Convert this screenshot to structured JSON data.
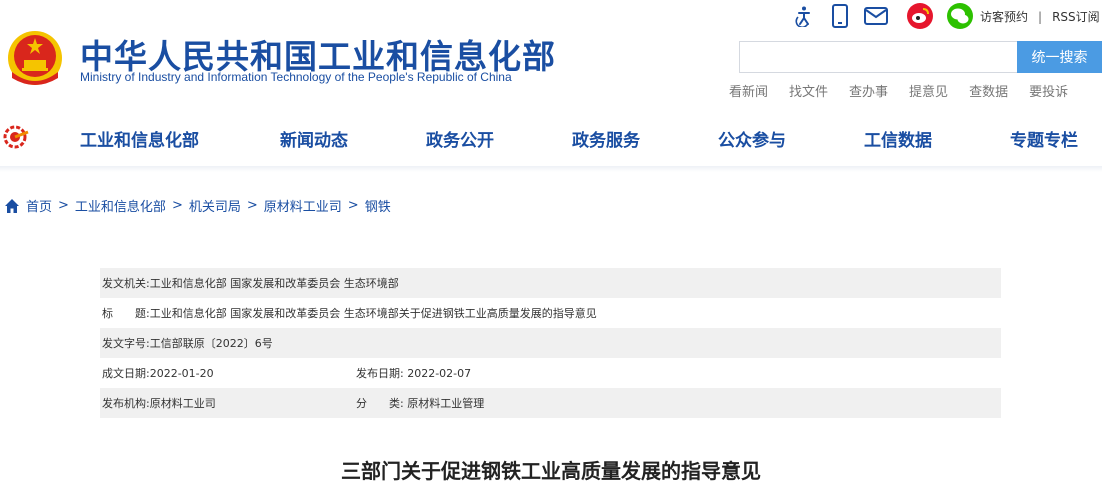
{
  "header": {
    "title_cn": "中华人民共和国工业和信息化部",
    "title_en": "Ministry of Industry and Information Technology of the People's Republic of China",
    "util_icons": [
      "accessibility-icon",
      "mobile-icon",
      "mail-icon",
      "weibo-icon",
      "wechat-icon"
    ],
    "util_links": {
      "visit": "访客预约",
      "separator": "|",
      "rss": "RSS订阅"
    },
    "search": {
      "placeholder": "",
      "button": "统一搜索"
    },
    "quick_links": [
      "看新闻",
      "找文件",
      "查办事",
      "提意见",
      "查数据",
      "要投诉"
    ]
  },
  "nav": {
    "items": [
      "工业和信息化部",
      "新闻动态",
      "政务公开",
      "政务服务",
      "公众参与",
      "工信数据",
      "专题专栏"
    ]
  },
  "breadcrumb": {
    "items": [
      "首页",
      "工业和信息化部",
      "机关司局",
      "原材料工业司",
      "钢铁"
    ],
    "separator": ">"
  },
  "meta": {
    "issuer_label": "发文机关:",
    "issuer": "工业和信息化部 国家发展和改革委员会 生态环境部",
    "title_label": "标　　题:",
    "title": "工业和信息化部 国家发展和改革委员会 生态环境部关于促进钢铁工业高质量发展的指导意见",
    "doc_no_label": "发文字号:",
    "doc_no": "工信部联原〔2022〕6号",
    "written_label": "成文日期:",
    "written": "2022-01-20",
    "published_label": "发布日期:",
    "published": "2022-02-07",
    "agency_label": "发布机构:",
    "agency": "原材料工业司",
    "category_label": "分　　类:",
    "category": "原材料工业管理"
  },
  "article": {
    "title": "三部门关于促进钢铁工业高质量发展的指导意见"
  },
  "colors": {
    "brand_blue": "#1a4ea2",
    "search_button": "#4b9be3",
    "emblem_red": "#d9261c",
    "emblem_gold": "#f5c400",
    "weibo": "#e6162d",
    "wechat": "#2dc100"
  }
}
